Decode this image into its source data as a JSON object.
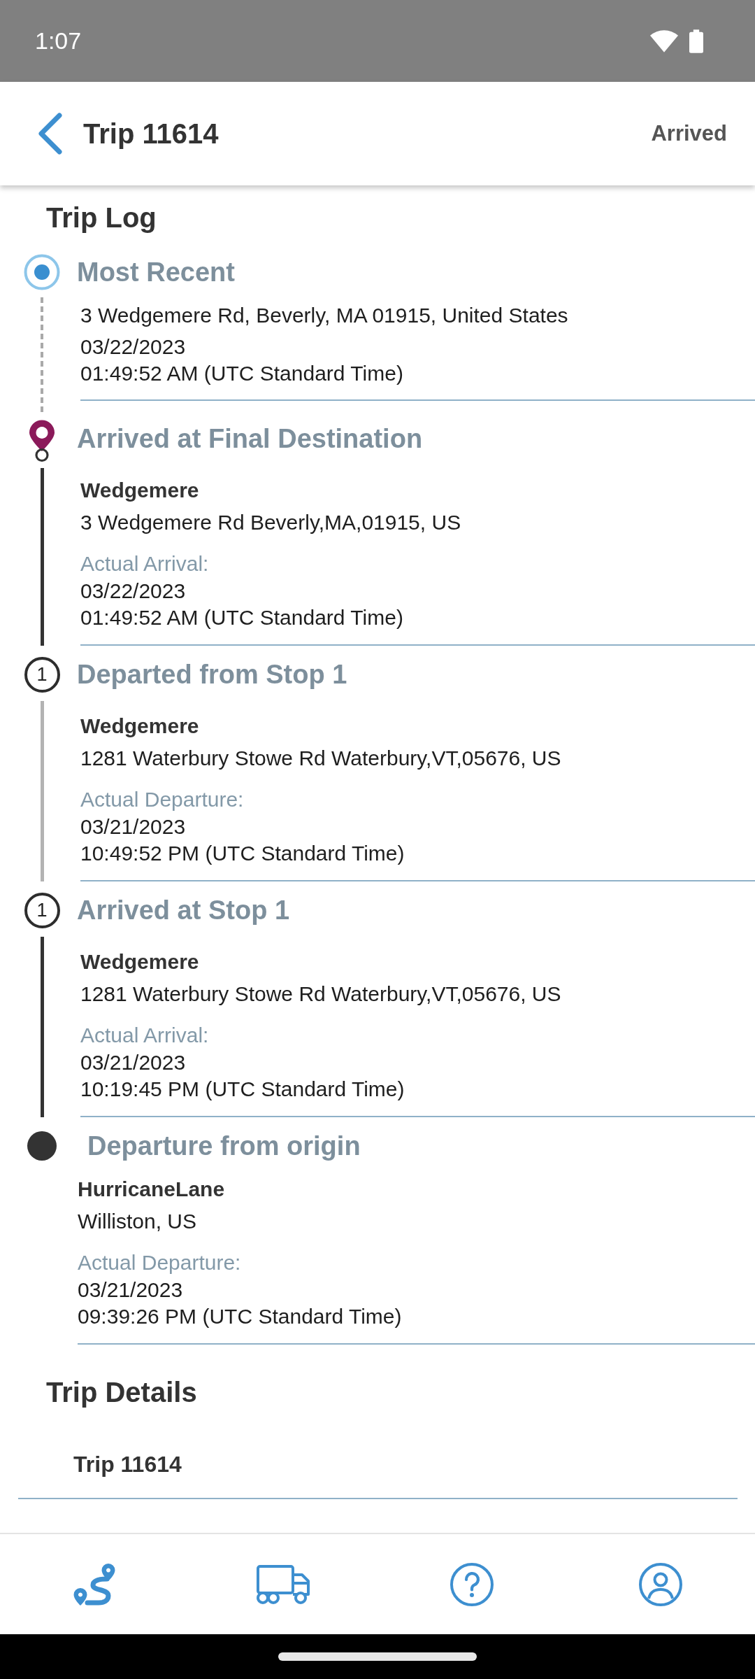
{
  "status_bar": {
    "time": "1:07"
  },
  "header": {
    "title": "Trip 11614",
    "status": "Arrived"
  },
  "trip_log": {
    "title": "Trip Log",
    "entries": [
      {
        "kind": "current",
        "connector": {
          "kind": "dashed"
        },
        "title": "Most Recent",
        "address": "3 Wedgemere Rd, Beverly, MA 01915, United States",
        "date": "03/22/2023",
        "time": "01:49:52 AM (UTC Standard Time)"
      },
      {
        "kind": "pin",
        "connector": {
          "kind": "solid"
        },
        "title": "Arrived at Final Destination",
        "name": "Wedgemere",
        "address": "3 Wedgemere Rd Beverly,MA,01915, US",
        "label": "Actual Arrival:",
        "date": "03/22/2023",
        "time": "01:49:52 AM (UTC Standard Time)"
      },
      {
        "kind": "stop",
        "marker": "1",
        "connector": {
          "kind": "faint"
        },
        "title": "Departed from Stop 1",
        "name": "Wedgemere",
        "address": "1281 Waterbury Stowe Rd Waterbury,VT,05676, US",
        "label": "Actual Departure:",
        "date": "03/21/2023",
        "time": "10:49:52 PM (UTC Standard Time)"
      },
      {
        "kind": "stop",
        "marker": "1",
        "connector": {
          "kind": "solid"
        },
        "title": "Arrived at Stop 1",
        "name": "Wedgemere",
        "address": "1281 Waterbury Stowe Rd Waterbury,VT,05676, US",
        "label": "Actual Arrival:",
        "date": "03/21/2023",
        "time": "10:19:45 PM (UTC Standard Time)"
      },
      {
        "kind": "origin",
        "title": "Departure from origin",
        "name": "HurricaneLane",
        "address": "Williston, US",
        "label": "Actual Departure:",
        "date": "03/21/2023",
        "time": "09:39:26 PM (UTC Standard Time)"
      }
    ]
  },
  "trip_details": {
    "title": "Trip Details",
    "items": [
      {
        "title": "Trip 11614"
      }
    ]
  }
}
